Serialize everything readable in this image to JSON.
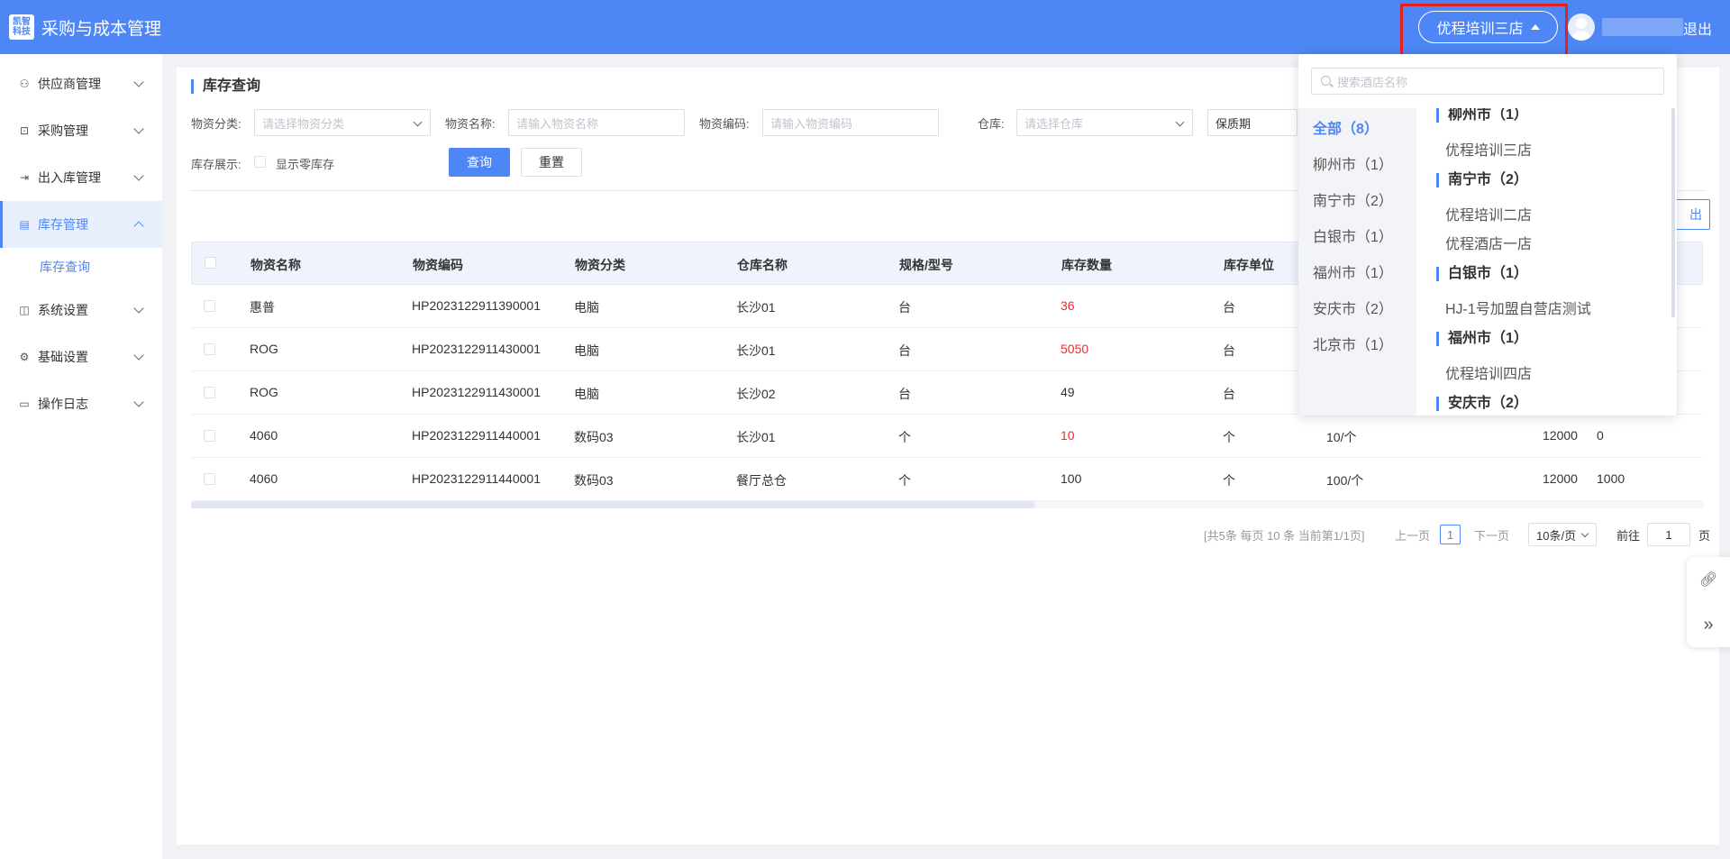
{
  "header": {
    "logo_text": "凯智科技",
    "app_title": "采购与成本管理",
    "current_store": "优程培训三店",
    "logout_label": "退出"
  },
  "sidebar": {
    "items": [
      {
        "label": "供应商管理",
        "icon": "supplier-icon"
      },
      {
        "label": "采购管理",
        "icon": "purchase-icon"
      },
      {
        "label": "出入库管理",
        "icon": "inout-icon"
      },
      {
        "label": "库存管理",
        "icon": "inventory-icon",
        "expanded": true
      },
      {
        "label": "系统设置",
        "icon": "system-icon"
      },
      {
        "label": "基础设置",
        "icon": "gear-icon"
      },
      {
        "label": "操作日志",
        "icon": "log-icon"
      }
    ],
    "submenu": {
      "label": "库存查询"
    }
  },
  "page": {
    "title": "库存查询",
    "filters": {
      "category_label": "物资分类:",
      "category_placeholder": "请选择物资分类",
      "name_label": "物资名称:",
      "name_placeholder": "请输入物资名称",
      "code_label": "物资编码:",
      "code_placeholder": "请输入物资编码",
      "warehouse_label": "仓库:",
      "warehouse_placeholder": "请选择仓库",
      "shelf_life_placeholder": "保质期",
      "display_label": "库存展示:",
      "show_zero_label": "显示零库存"
    },
    "query_button": "查询",
    "reset_button": "重置",
    "export_button": "出"
  },
  "table": {
    "headers": [
      "物资名称",
      "物资编码",
      "物资分类",
      "仓库名称",
      "规格/型号",
      "库存数量",
      "库存单位"
    ],
    "rows": [
      {
        "name": "惠普",
        "code": "HP2023122911390001",
        "category": "电脑",
        "warehouse": "长沙01",
        "spec": "台",
        "qty": "36",
        "qty_red": true,
        "unit": "台",
        "extra1": "",
        "extra2": "",
        "extra3": ""
      },
      {
        "name": "ROG",
        "code": "HP2023122911430001",
        "category": "电脑",
        "warehouse": "长沙01",
        "spec": "台",
        "qty": "5050",
        "qty_red": true,
        "unit": "台",
        "extra1": "",
        "extra2": "",
        "extra3": ""
      },
      {
        "name": "ROG",
        "code": "HP2023122911430001",
        "category": "电脑",
        "warehouse": "长沙02",
        "spec": "台",
        "qty": "49",
        "qty_red": false,
        "unit": "台",
        "extra1": "",
        "extra2": "",
        "extra3": ""
      },
      {
        "name": "4060",
        "code": "HP2023122911440001",
        "category": "数码03",
        "warehouse": "长沙01",
        "spec": "个",
        "qty": "10",
        "qty_red": true,
        "unit": "个",
        "extra1": "10/个",
        "extra2": "12000",
        "extra3": "0"
      },
      {
        "name": "4060",
        "code": "HP2023122911440001",
        "category": "数码03",
        "warehouse": "餐厅总仓",
        "spec": "个",
        "qty": "100",
        "qty_red": false,
        "unit": "个",
        "extra1": "100/个",
        "extra2": "12000",
        "extra3": "1000"
      }
    ]
  },
  "pagination": {
    "summary": "[共5条 每页 10 条 当前第1/1页]",
    "prev": "上一页",
    "current": "1",
    "next": "下一页",
    "page_size": "10条/页",
    "goto_label": "前往",
    "goto_value": "1",
    "page_suffix": "页"
  },
  "store_dropdown": {
    "search_placeholder": "搜索酒店名称",
    "cities": [
      "全部（8）",
      "柳州市（1）",
      "南宁市（2）",
      "白银市（1）",
      "福州市（1）",
      "安庆市（2）",
      "北京市（1）"
    ],
    "groups": [
      {
        "title": "柳州市（1）",
        "stores": [
          "优程培训三店"
        ]
      },
      {
        "title": "南宁市（2）",
        "stores": [
          "优程培训二店",
          "优程酒店一店"
        ]
      },
      {
        "title": "白银市（1）",
        "stores": [
          "HJ-1号加盟自营店测试"
        ]
      },
      {
        "title": "福州市（1）",
        "stores": [
          "优程培训四店"
        ]
      },
      {
        "title": "安庆市（2）",
        "stores": []
      }
    ]
  },
  "colors": {
    "primary": "#4e86f5",
    "danger": "#f02b2b",
    "highlight": "#e32020"
  }
}
